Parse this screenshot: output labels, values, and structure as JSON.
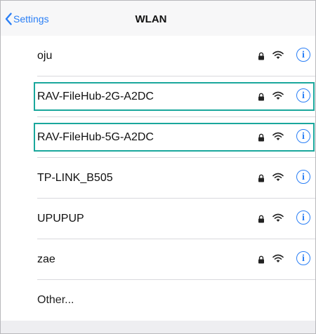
{
  "navbar": {
    "back_label": "Settings",
    "title": "WLAN"
  },
  "networks": [
    {
      "name": "oju",
      "secured": true
    },
    {
      "name": "RAV-FileHub-2G-A2DC",
      "secured": true,
      "highlighted": true
    },
    {
      "name": "RAV-FileHub-5G-A2DC",
      "secured": true,
      "highlighted": true
    },
    {
      "name": "TP-LINK_B505",
      "secured": true
    },
    {
      "name": "UPUPUP",
      "secured": true
    },
    {
      "name": "zae",
      "secured": true
    }
  ],
  "other_label": "Other...",
  "info_glyph": "i",
  "icons": {
    "back": "chevron-left-icon",
    "lock": "lock-icon",
    "wifi": "wifi-icon",
    "info": "info-icon"
  },
  "colors": {
    "accent": "#2a7ff6",
    "highlight_box": "#1aa79c"
  }
}
